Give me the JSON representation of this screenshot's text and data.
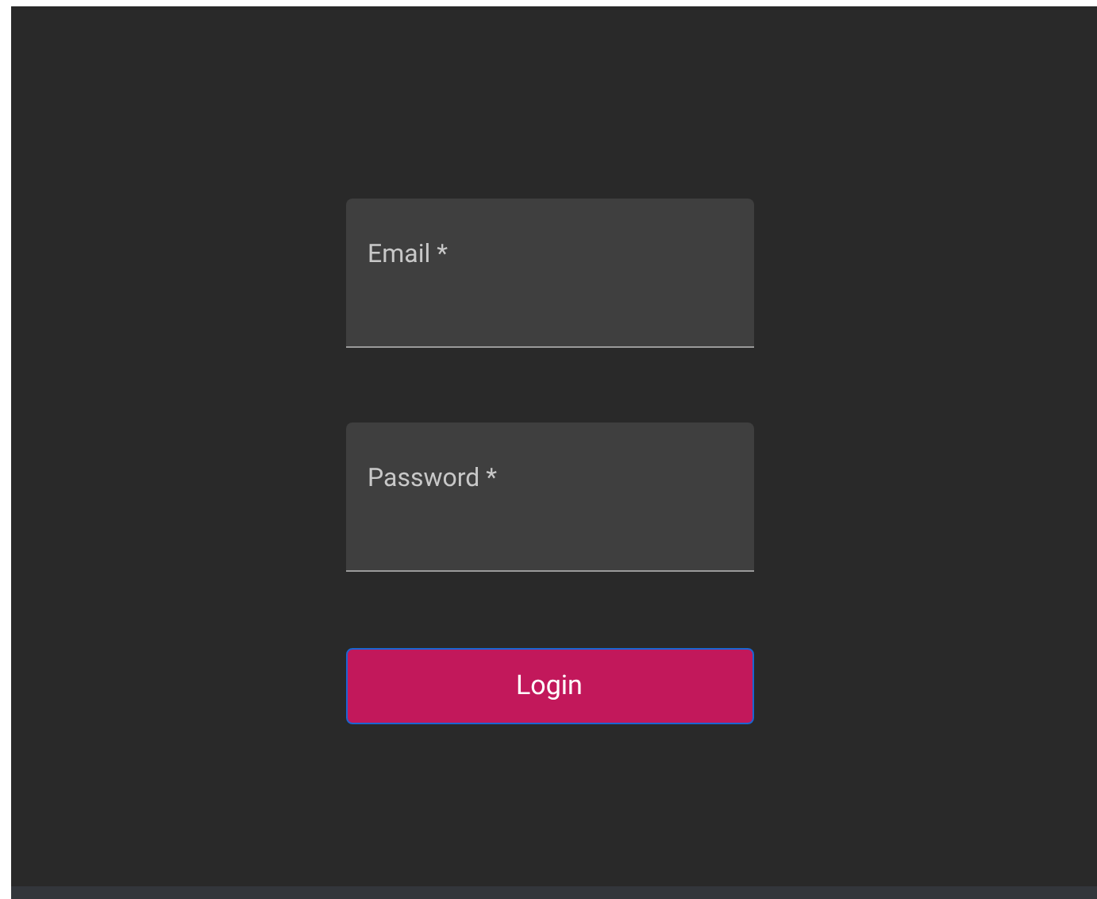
{
  "fields": [
    {
      "label": "Email *"
    },
    {
      "label": "Password *"
    }
  ],
  "login_button": {
    "label": "Login",
    "focused": true
  }
}
